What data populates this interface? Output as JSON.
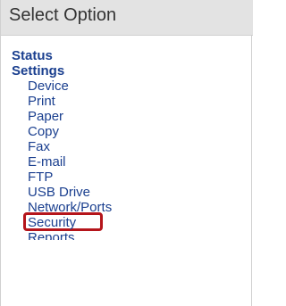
{
  "header": {
    "title": "Select Option"
  },
  "menu": {
    "sections": [
      {
        "label": "Status"
      },
      {
        "label": "Settings"
      }
    ],
    "settings_items": [
      {
        "label": "Device"
      },
      {
        "label": "Print"
      },
      {
        "label": "Paper"
      },
      {
        "label": "Copy"
      },
      {
        "label": "Fax"
      },
      {
        "label": "E-mail"
      },
      {
        "label": "FTP"
      },
      {
        "label": "USB Drive"
      },
      {
        "label": "Network/Ports"
      },
      {
        "label": "Security"
      },
      {
        "label": "Reports"
      }
    ],
    "highlighted_item": "Security",
    "colors": {
      "link": "#1a3f8f",
      "highlight_border": "#b5151b",
      "header_bg": "#e3e3e3"
    }
  }
}
